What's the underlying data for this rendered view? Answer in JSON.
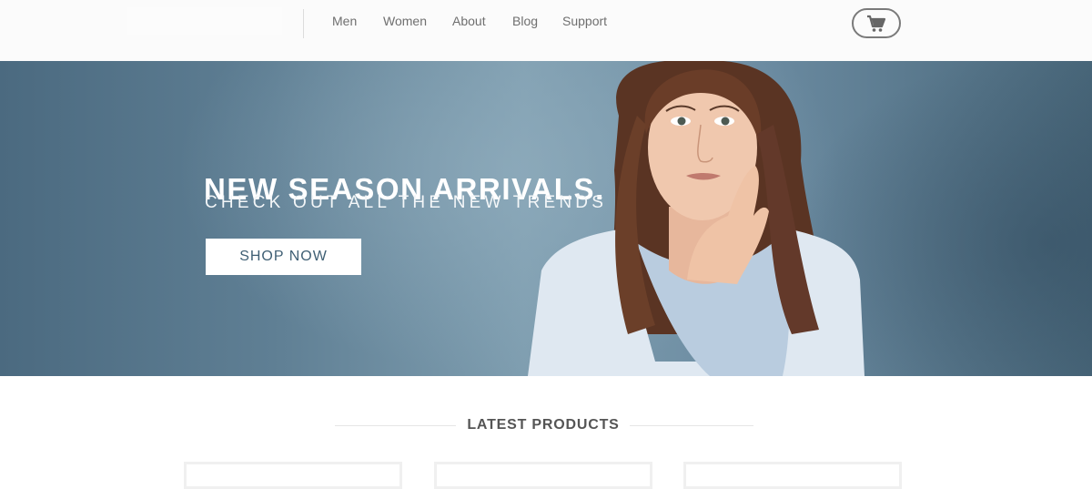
{
  "nav": {
    "items": [
      {
        "label": "Men"
      },
      {
        "label": "Women"
      },
      {
        "label": "About"
      },
      {
        "label": "Blog"
      },
      {
        "label": "Support"
      }
    ],
    "cart_icon": "shopping-cart-icon"
  },
  "hero": {
    "title": "NEW SEASON ARRIVALS.",
    "subtitle": "CHECK OUT ALL THE NEW TRENDS",
    "cta_label": "SHOP NOW"
  },
  "products": {
    "heading": "LATEST PRODUCTS"
  },
  "colors": {
    "hero_bg": "#5f7f94",
    "cta_text": "#3f5f74",
    "nav_text": "#6f6f6f"
  }
}
